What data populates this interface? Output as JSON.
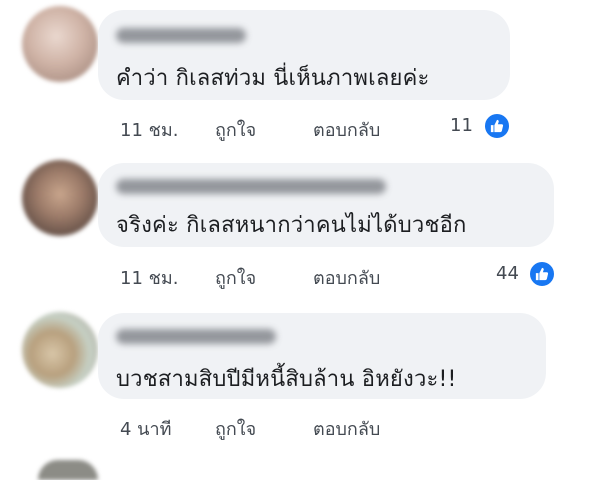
{
  "comments": [
    {
      "text": "คำว่า กิเลสท่วม นี่เห็นภาพเลยค่ะ",
      "time": "11 ชม.",
      "like_label": "ถูกใจ",
      "reply_label": "ตอบกลับ",
      "reaction_count": "11"
    },
    {
      "text": "จริงค่ะ กิเลสหนากว่าคนไม่ได้บวชอีก",
      "time": "11 ชม.",
      "like_label": "ถูกใจ",
      "reply_label": "ตอบกลับ",
      "reaction_count": "44"
    },
    {
      "text": "บวชสามสิบปีมีหนี้สิบล้าน อิหยังวะ!!",
      "time": "4 นาที",
      "like_label": "ถูกใจ",
      "reply_label": "ตอบกลับ"
    }
  ],
  "colors": {
    "bubble": "#f0f2f5",
    "like_blue": "#1877f2",
    "meta_text": "#444a52"
  },
  "icons": {
    "reaction": "like-thumbs-up-icon"
  }
}
